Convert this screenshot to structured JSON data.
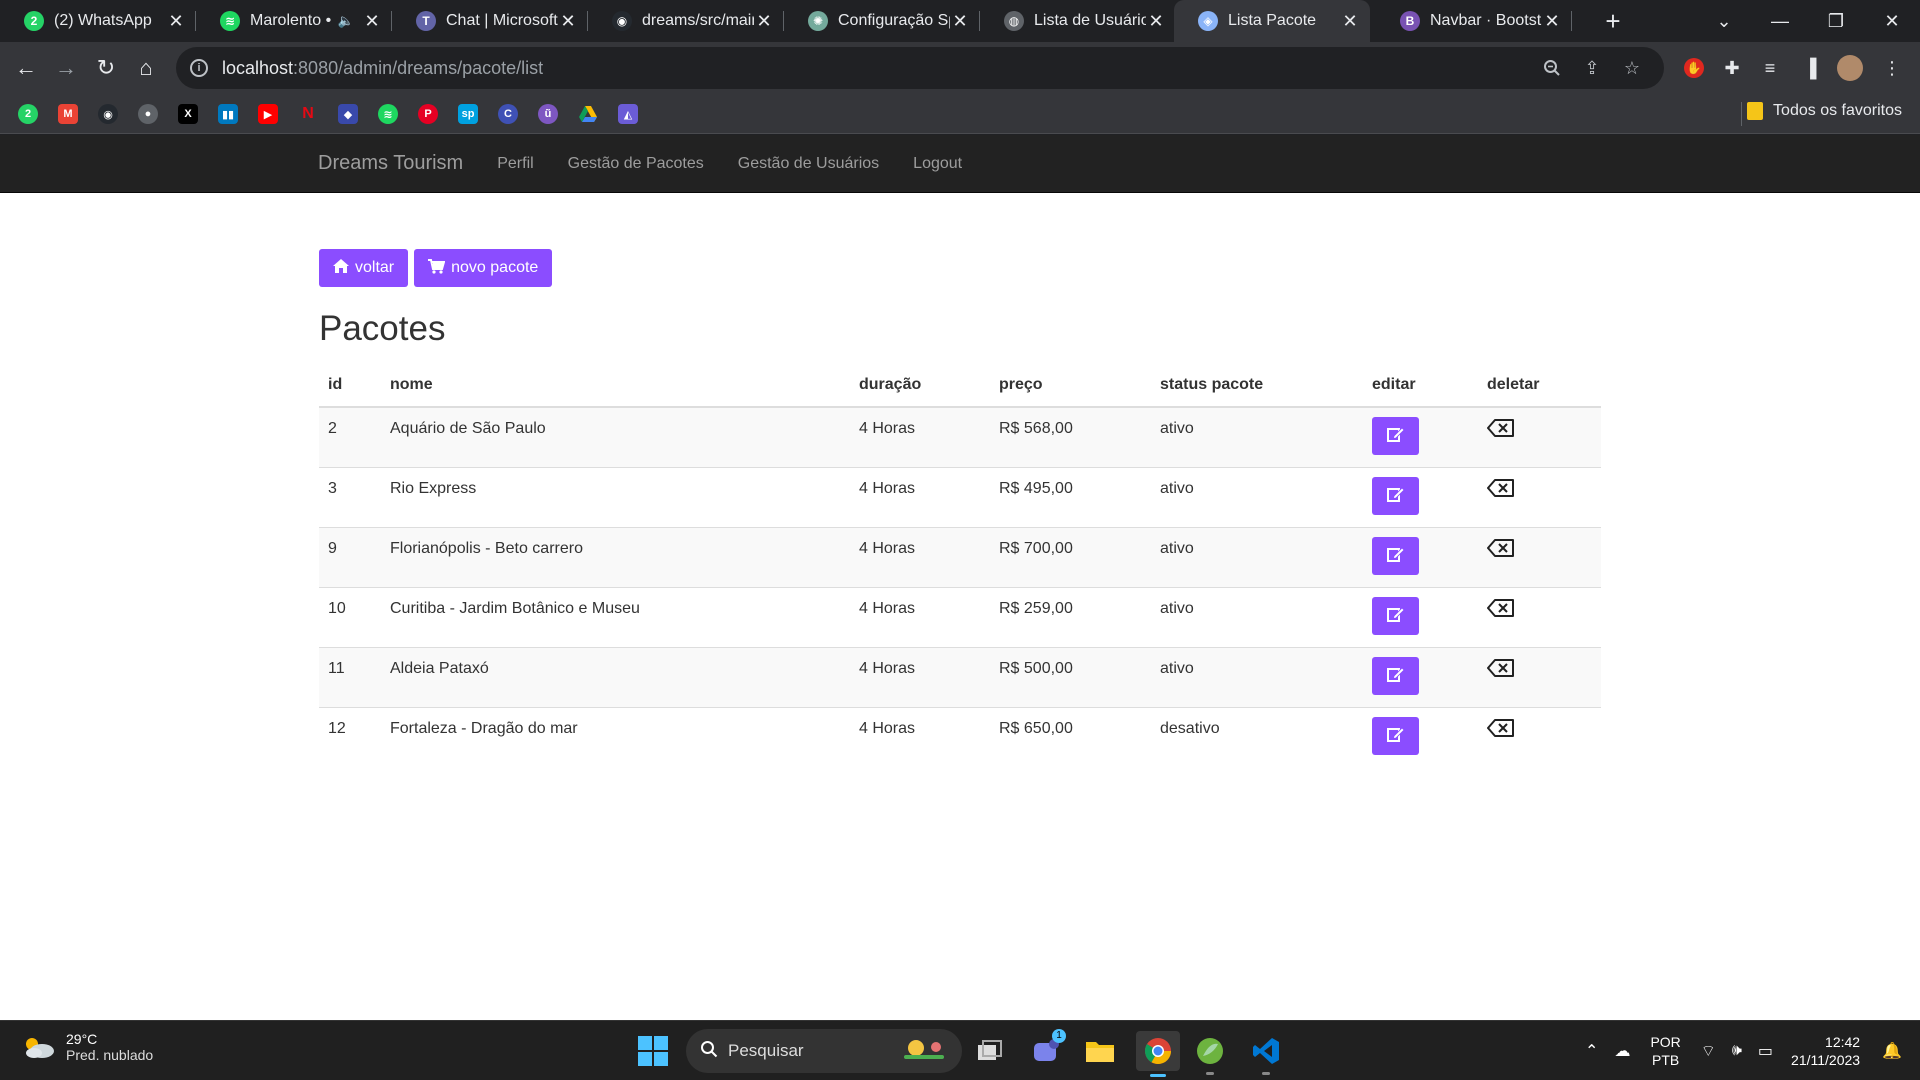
{
  "browser": {
    "tabs": [
      {
        "title": "(2) WhatsApp",
        "icon": "whatsapp-icon",
        "color": "#25d366",
        "glyph": "2"
      },
      {
        "title": "Marolento •",
        "icon": "spotify-icon",
        "color": "#1ed760",
        "glyph": "≋",
        "muted": true
      },
      {
        "title": "Chat | Microsoft",
        "icon": "teams-icon",
        "color": "#6264a7",
        "glyph": "T"
      },
      {
        "title": "dreams/src/main",
        "icon": "github-icon",
        "color": "#24292f",
        "glyph": "◉"
      },
      {
        "title": "Configuração Sp",
        "icon": "chatgpt-icon",
        "color": "#74aa9c",
        "glyph": "✺"
      },
      {
        "title": "Lista de Usuários",
        "icon": "globe-icon",
        "color": "#5f6368",
        "glyph": "◍"
      },
      {
        "title": "Lista Pacote",
        "icon": "app-icon",
        "color": "#8ab4f8",
        "glyph": "◈",
        "active": true
      },
      {
        "title": "Navbar · Bootstra",
        "icon": "bootstrap-icon",
        "color": "#7952b3",
        "glyph": "B"
      }
    ],
    "url_host": "localhost",
    "url_path": ":8080/admin/dreams/pacote/list",
    "bookmarks_folder": "Todos os favoritos"
  },
  "site": {
    "brand": "Dreams Tourism",
    "nav": [
      "Perfil",
      "Gestão de Pacotes",
      "Gestão de Usuários",
      "Logout"
    ]
  },
  "page": {
    "back_label": "voltar",
    "new_label": "novo pacote",
    "title": "Pacotes",
    "accent": "#8b4dff",
    "columns": [
      "id",
      "nome",
      "duração",
      "preço",
      "status pacote",
      "editar",
      "deletar"
    ],
    "rows": [
      {
        "id": "2",
        "nome": "Aquário de São Paulo",
        "duracao": "4 Horas",
        "preco": "R$ 568,00",
        "status": "ativo"
      },
      {
        "id": "3",
        "nome": "Rio Express",
        "duracao": "4 Horas",
        "preco": "R$ 495,00",
        "status": "ativo"
      },
      {
        "id": "9",
        "nome": "Florianópolis - Beto carrero",
        "duracao": "4 Horas",
        "preco": "R$ 700,00",
        "status": "ativo"
      },
      {
        "id": "10",
        "nome": "Curitiba - Jardim Botânico e Museu",
        "duracao": "4 Horas",
        "preco": "R$ 259,00",
        "status": "ativo"
      },
      {
        "id": "11",
        "nome": "Aldeia Pataxó",
        "duracao": "4 Horas",
        "preco": "R$ 500,00",
        "status": "ativo"
      },
      {
        "id": "12",
        "nome": "Fortaleza - Dragão do mar",
        "duracao": "4 Horas",
        "preco": "R$ 650,00",
        "status": "desativo"
      }
    ]
  },
  "taskbar": {
    "weather_temp": "29°C",
    "weather_desc": "Pred. nublado",
    "search_placeholder": "Pesquisar",
    "lang_1": "POR",
    "lang_2": "PTB",
    "time": "12:42",
    "date": "21/11/2023",
    "teams_badge": "1"
  }
}
